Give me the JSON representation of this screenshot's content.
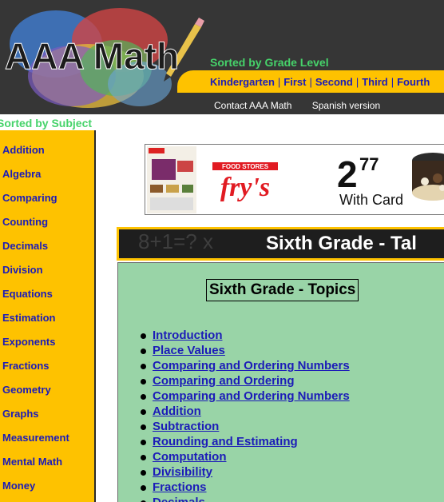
{
  "header": {
    "logo_text": "AAA Math",
    "sorted_by_grade": "Sorted by Grade Level",
    "grades": [
      "Kindergarten",
      "First",
      "Second",
      "Third",
      "Fourth"
    ],
    "contact_link": "Contact AAA Math",
    "spanish_link": "Spanish version"
  },
  "sidebar": {
    "title": "Sorted by Subject",
    "items": [
      {
        "label": "Addition"
      },
      {
        "label": "Algebra"
      },
      {
        "label": "Comparing"
      },
      {
        "label": "Counting"
      },
      {
        "label": "Decimals"
      },
      {
        "label": "Division"
      },
      {
        "label": "Equations"
      },
      {
        "label": "Estimation"
      },
      {
        "label": "Exponents"
      },
      {
        "label": "Fractions"
      },
      {
        "label": "Geometry"
      },
      {
        "label": "Graphs"
      },
      {
        "label": "Measurement"
      },
      {
        "label": "Mental Math"
      },
      {
        "label": "Money"
      }
    ]
  },
  "ad": {
    "brand": "fry's",
    "brand_tagline": "FOOD STORES",
    "price_dollars": "2",
    "price_cents": "77",
    "with_card": "With Card"
  },
  "banner": {
    "title": "Sixth Grade - Tal",
    "deco": "8+1=?      x"
  },
  "topics": {
    "heading": "Sixth Grade - Topics",
    "items": [
      {
        "label": "Introduction"
      },
      {
        "label": "Place Values"
      },
      {
        "label": "Comparing and Ordering Numbers"
      },
      {
        "label": "Comparing and Ordering"
      },
      {
        "label": "Comparing and Ordering Numbers"
      },
      {
        "label": "Addition"
      },
      {
        "label": "Subtraction"
      },
      {
        "label": "Rounding and Estimating"
      },
      {
        "label": "Computation"
      },
      {
        "label": "Divisibility"
      },
      {
        "label": "Fractions"
      },
      {
        "label": "Decimals"
      }
    ]
  },
  "colors": {
    "header_bg": "#363636",
    "accent_yellow": "#fec200",
    "link_blue": "#1c1cb8",
    "green_text": "#46d36a",
    "topics_bg": "#99d4a7"
  }
}
